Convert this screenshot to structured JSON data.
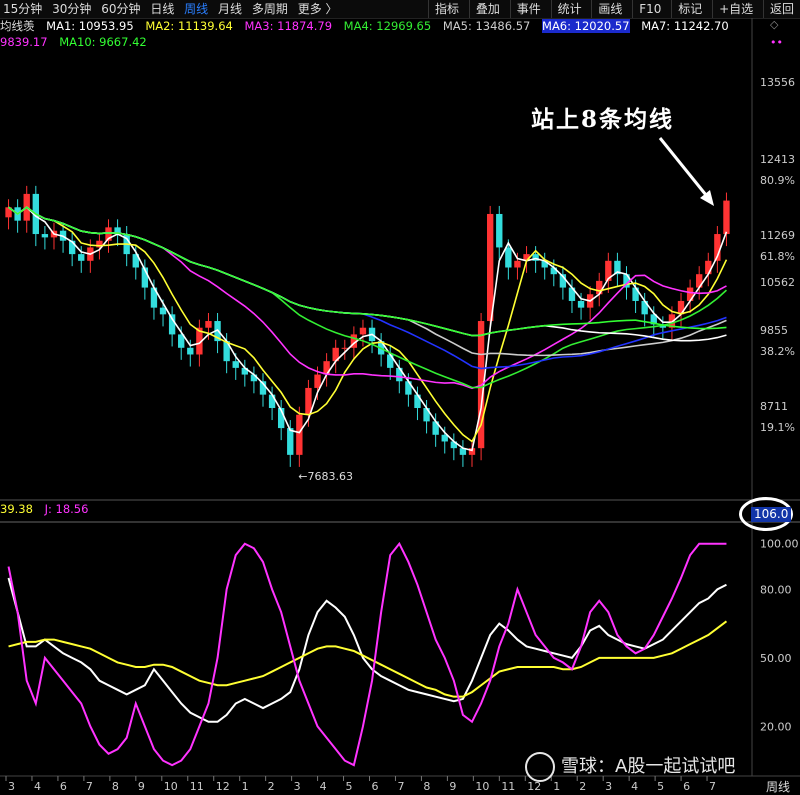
{
  "toolbar": {
    "periods": [
      "15分钟",
      "30分钟",
      "60分钟",
      "日线",
      "周线",
      "月线",
      "多周期",
      "更多 〉"
    ],
    "active_index": 4,
    "right": [
      "指标",
      "叠加",
      "事件",
      "统计",
      "画线",
      "F10",
      "标记",
      "+自选",
      "返回"
    ]
  },
  "ma_labels": {
    "name": "均线羡",
    "ma1": "MA1: 10953.95",
    "ma2": "MA2: 11139.64",
    "ma3": "MA3: 11874.79",
    "ma4": "MA4: 12969.65",
    "ma5": "MA5: 13486.57",
    "ma6": "MA6: 12020.57",
    "ma7": "MA7: 11242.70",
    "ma9": "9839.17",
    "ma10": "MA10: 9667.42"
  },
  "kdj_labels": {
    "d": "39.38",
    "j": "J: 18.56"
  },
  "price_axis": [
    {
      "label": "13556"
    },
    {
      "label": "12413"
    },
    {
      "label": "80.9%"
    },
    {
      "label": "11269"
    },
    {
      "label": "61.8%"
    },
    {
      "label": "10562"
    },
    {
      "label": "9855"
    },
    {
      "label": "38.2%"
    },
    {
      "label": "8711"
    },
    {
      "label": "19.1%"
    }
  ],
  "kdj_axis": [
    "100.00",
    "80.00",
    "50.00",
    "20.00"
  ],
  "low_marker": "←7683.63",
  "annotation": "站上8条均线",
  "badge": "106.0",
  "watermark": "雪球：A股一起试试吧",
  "period_label": "周线",
  "date_ticks": [
    "3",
    "4",
    "6",
    "7",
    "8",
    "9",
    "10",
    "11",
    "12",
    "1",
    "2",
    "3",
    "4",
    "5",
    "6",
    "7",
    "8",
    "9",
    "10",
    "11",
    "12",
    "1",
    "2",
    "3",
    "4",
    "5",
    "6",
    "7"
  ],
  "colors": {
    "ma1": "#ffffff",
    "ma2": "#ffff33",
    "ma3": "#ff33ff",
    "ma4": "#33ee33",
    "ma5": "#cccccc",
    "ma6": "#2233ff",
    "ma7": "#ffffff",
    "ma10": "#33ff33",
    "up": "#ff3333",
    "down": "#33dddd"
  },
  "chart_data": [
    {
      "type": "candlestick",
      "title": "",
      "low_label": "7683.63",
      "ylim": [
        7400,
        14200
      ],
      "closes": [
        11700,
        11500,
        11900,
        11300,
        11250,
        11350,
        11200,
        11000,
        10900,
        11100,
        11200,
        11400,
        11300,
        11000,
        10800,
        10500,
        10200,
        10100,
        9800,
        9600,
        9500,
        9900,
        10000,
        9700,
        9400,
        9300,
        9200,
        9100,
        8900,
        8700,
        8400,
        8000,
        8600,
        9000,
        9200,
        9400,
        9600,
        9600,
        9800,
        9900,
        9700,
        9500,
        9300,
        9100,
        8900,
        8700,
        8500,
        8300,
        8200,
        8100,
        8000,
        8100,
        10000,
        11600,
        11100,
        10800,
        10900,
        11000,
        10900,
        10800,
        10700,
        10500,
        10300,
        10200,
        10400,
        10600,
        10900,
        10700,
        10500,
        10300,
        10100,
        9950,
        9900,
        10100,
        10300,
        10500,
        10700,
        10900,
        11300,
        11800
      ]
    },
    {
      "type": "line",
      "title": "",
      "ylim": [
        0,
        106
      ],
      "series": [
        {
          "values": [
            85,
            70,
            55,
            55,
            58,
            55,
            52,
            50,
            48,
            45,
            40,
            38,
            36,
            34,
            36,
            38,
            45,
            40,
            35,
            30,
            26,
            24,
            22,
            22,
            25,
            30,
            32,
            30,
            28,
            30,
            32,
            35,
            45,
            60,
            70,
            75,
            72,
            68,
            60,
            50,
            45,
            42,
            40,
            38,
            36,
            35,
            34,
            33,
            32,
            31,
            32,
            40,
            50,
            60,
            65,
            62,
            58,
            55,
            54,
            53,
            52,
            51,
            50,
            55,
            62,
            64,
            60,
            58,
            56,
            55,
            54,
            56,
            58,
            62,
            66,
            70,
            74,
            76,
            80,
            82
          ]
        },
        {
          "values": [
            55,
            56,
            57,
            57,
            58,
            58,
            57,
            56,
            55,
            54,
            52,
            50,
            48,
            47,
            46,
            46,
            47,
            47,
            46,
            44,
            42,
            40,
            39,
            38,
            38,
            39,
            40,
            41,
            42,
            44,
            46,
            48,
            50,
            52,
            54,
            55,
            55,
            54,
            53,
            51,
            49,
            47,
            45,
            43,
            41,
            39,
            37,
            36,
            34,
            33,
            33,
            35,
            38,
            41,
            44,
            45,
            46,
            46,
            46,
            46,
            46,
            45,
            45,
            46,
            48,
            50,
            50,
            50,
            50,
            50,
            50,
            50,
            51,
            52,
            54,
            56,
            58,
            60,
            63,
            66
          ]
        },
        {
          "values": [
            90,
            70,
            40,
            30,
            50,
            45,
            40,
            35,
            30,
            20,
            12,
            8,
            10,
            15,
            30,
            20,
            10,
            5,
            3,
            5,
            10,
            20,
            30,
            50,
            80,
            95,
            100,
            98,
            92,
            80,
            70,
            55,
            40,
            30,
            20,
            15,
            10,
            5,
            3,
            20,
            40,
            70,
            95,
            100,
            92,
            82,
            70,
            58,
            50,
            40,
            25,
            22,
            30,
            40,
            55,
            65,
            80,
            70,
            60,
            55,
            50,
            48,
            45,
            55,
            70,
            75,
            70,
            60,
            55,
            52,
            54,
            60,
            68,
            76,
            85,
            95,
            100,
            100,
            100,
            100
          ]
        }
      ]
    }
  ]
}
